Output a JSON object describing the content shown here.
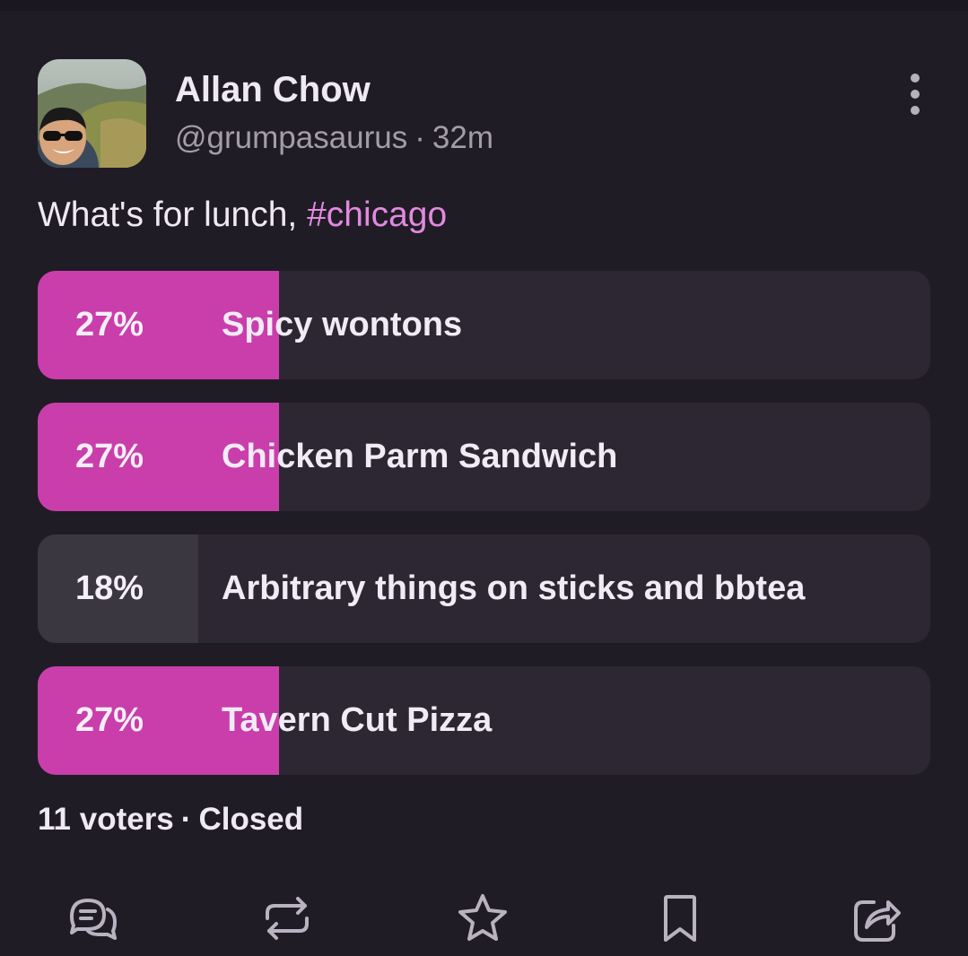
{
  "post": {
    "display_name": "Allan Chow",
    "handle": "@grumpasaurus",
    "separator": "·",
    "time": "32m",
    "text": "What's for lunch, ",
    "hashtag": "#chicago"
  },
  "poll": {
    "options": [
      {
        "percent_label": "27%",
        "label": "Spicy wontons",
        "percent": 27,
        "winner": true
      },
      {
        "percent_label": "27%",
        "label": "Chicken Parm Sandwich",
        "percent": 27,
        "winner": true
      },
      {
        "percent_label": "18%",
        "label": "Arbitrary things on sticks and bbtea",
        "percent": 18,
        "winner": false
      },
      {
        "percent_label": "27%",
        "label": "Tavern Cut Pizza",
        "percent": 27,
        "winner": true
      }
    ],
    "voters": "11 voters",
    "separator": "·",
    "status": "Closed"
  },
  "colors": {
    "winner_fill": "#c93eab",
    "other_fill": "#3b3741",
    "track": "#2c2733",
    "hashtag": "#e289e0"
  },
  "icons": [
    "more-vert-icon",
    "reply-icon",
    "boost-icon",
    "favourite-icon",
    "bookmark-icon",
    "share-icon"
  ]
}
